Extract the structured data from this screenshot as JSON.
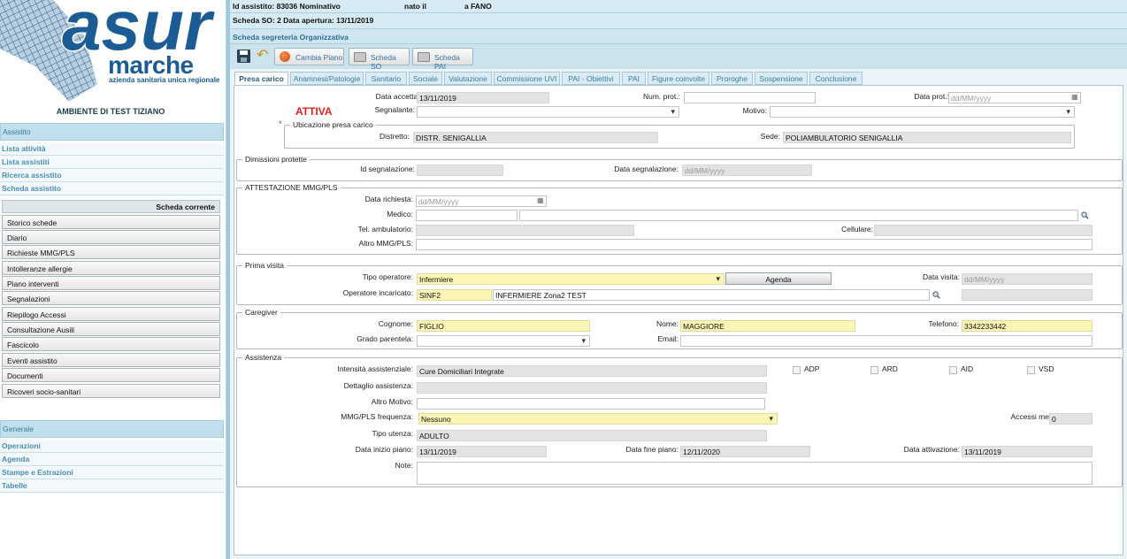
{
  "logo": {
    "brand": "asur",
    "name": "marche",
    "tagline": "azienda sanitaria unica regionale"
  },
  "environment": "AMBIENTE DI TEST TIZIANO",
  "nav": {
    "assistito_header": "Assistito",
    "assistito_links": [
      "Lista attività",
      "Lista assistiti",
      "Ricerca assistito",
      "Scheda assistito"
    ],
    "scheda_corrente": "Scheda corrente",
    "scheda_buttons": [
      "Storico schede",
      "Diario",
      "Richieste MMG/PLS",
      "Intolleranze allergie",
      "Piano interventi",
      "Segnalazioni",
      "Riepilogo Accessi",
      "Consultazione Ausili",
      "Fascicolo",
      "Eventi assistito",
      "Documenti",
      "Ricoveri socio-sanitari"
    ],
    "generale_header": "Generale",
    "generale_links": [
      "Operazioni",
      "Agenda",
      "Stampe e Estrazioni",
      "Tabelle"
    ]
  },
  "topbar": {
    "id": "Id assistito: 83036 Nominativo",
    "nato": "nato il",
    "luogo": "a FANO",
    "scheda": "Scheda SO: 2 Data apertura: 13/11/2019"
  },
  "section_title": "Scheda segreteria Organizzativa",
  "toolbar": {
    "cambia_piano": "Cambia Piano",
    "scheda_so": "Scheda SO",
    "scheda_pai": "Scheda PAI",
    "icons": [
      "save-icon",
      "undo-icon"
    ]
  },
  "tabs": [
    "Presa carico",
    "Anamnesi/Patologie",
    "Sanitario",
    "Sociale",
    "Valutazione",
    "Commissione UVI",
    "PAI - Obiettivi",
    "PAI",
    "Figure coinvolte",
    "Proroghe",
    "Sospensione",
    "Conclusione"
  ],
  "presa": {
    "data_accettazione_label": "Data accettazione:",
    "data_accettazione": "13/11/2019",
    "num_prot_label": "Num. prot.:",
    "data_prot_label": "Data prot.:",
    "date_placeholder": "dd/MM/yyyy",
    "status": "ATTIVA",
    "required_mark": "*",
    "segnalante_label": "Segnalante:",
    "motivo_label": "Motivo:",
    "ubicazione_legend": "Ubicazione presa carico",
    "distretto_label": "Distretto:",
    "distretto": "DISTR. SENIGALLIA",
    "sede_label": "Sede:",
    "sede": "POLIAMBULATORIO SENIGALLIA"
  },
  "dimissioni": {
    "legend": "Dimissioni protette",
    "id_label": "Id segnalazione:",
    "data_label": "Data segnalazione:"
  },
  "attestazione": {
    "legend": "ATTESTAZIONE MMG/PLS",
    "data_richiesta_label": "Data richiesta:",
    "medico_label": "Medico:",
    "tel_label": "Tel. ambulatorio:",
    "cellulare_label": "Cellulare:",
    "altro_label": "Altro MMG/PLS:"
  },
  "prima_visita": {
    "legend": "Prima visita",
    "tipo_label": "Tipo operatore:",
    "tipo": "Infermiere",
    "agenda": "Agenda",
    "data_visita_label": "Data visita:",
    "operatore_label": "Operatore incaricato:",
    "operatore_code": "SINF2",
    "operatore_name": "INFERMIERE Zona2 TEST"
  },
  "caregiver": {
    "legend": "Caregiver",
    "cognome_label": "Cognome:",
    "cognome": "FIGLIO",
    "nome_label": "Nome:",
    "nome": "MAGGIORE",
    "telefono_label": "Telefono:",
    "telefono": "3342233442",
    "grado_label": "Grado parentela:",
    "email_label": "Email:"
  },
  "assistenza": {
    "legend": "Assistenza",
    "intensita_label": "Intensità assistenziale:",
    "intensita": "Cure Domiciliari Integrate",
    "checks": [
      "ADP",
      "ARD",
      "AID",
      "VSD"
    ],
    "dettaglio_label": "Dettaglio assistenza:",
    "altro_motivo_label": "Altro Motivo:",
    "mmg_freq_label": "MMG/PLS frequenza:",
    "mmg_freq": "Nessuno",
    "accessi_label": "Accessi mensili:",
    "accessi": "0",
    "tipo_utenza_label": "Tipo utenza:",
    "tipo_utenza": "ADULTO",
    "data_inizio_label": "Data inizio piano:",
    "data_inizio": "13/11/2019",
    "data_fine_label": "Data fine piano:",
    "data_fine": "12/11/2020",
    "data_attivazione_label": "Data attivazione:",
    "data_attivazione": "13/11/2019",
    "note_label": "Note:"
  }
}
